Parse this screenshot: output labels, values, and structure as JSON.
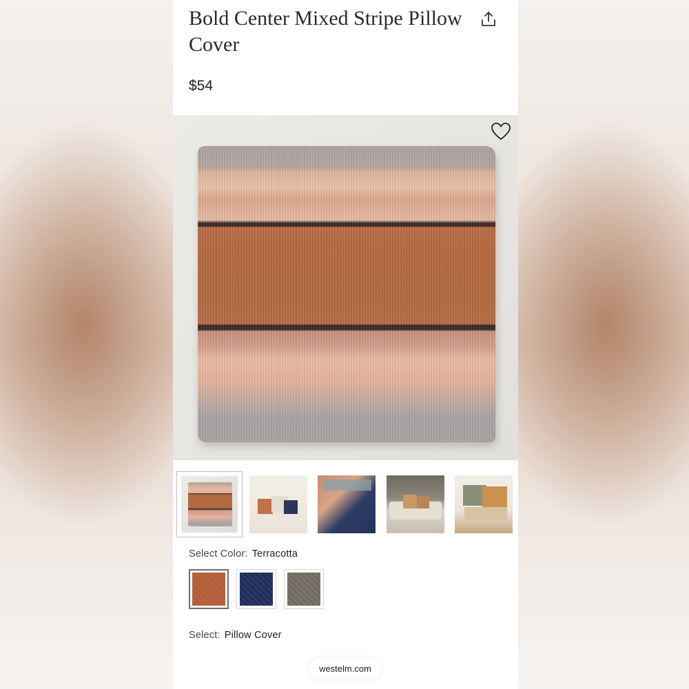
{
  "product": {
    "title": "Bold Center Mixed Stripe Pillow Cover",
    "price": "$54"
  },
  "icons": {
    "share": "share-upload-icon",
    "favorite": "heart-outline-icon"
  },
  "gallery": {
    "thumbnail_count": 5,
    "selected_index": 0
  },
  "color": {
    "label": "Select Color:",
    "selected": "Terracotta",
    "swatches": [
      {
        "color": "#b8643f",
        "selected": true
      },
      {
        "color": "#1f2d57",
        "selected": false
      },
      {
        "color": "#7c756b",
        "selected": false
      }
    ]
  },
  "type": {
    "label": "Select:",
    "selected": "Pillow Cover"
  },
  "browser": {
    "domain": "westelm.com"
  }
}
